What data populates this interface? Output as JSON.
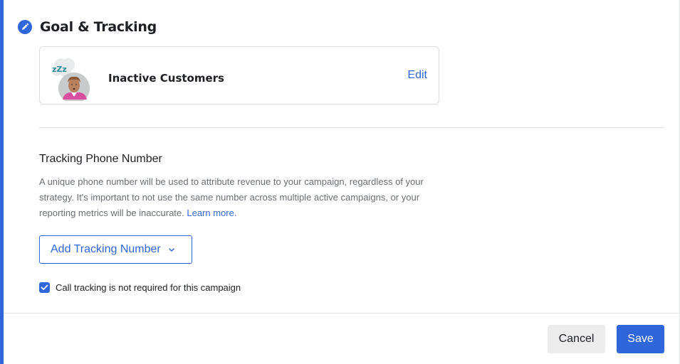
{
  "section": {
    "title": "Goal & Tracking",
    "icon": "pencil-icon"
  },
  "goal": {
    "name": "Inactive Customers",
    "edit_label": "Edit",
    "avatar_icon": "sleeping-customer-avatar",
    "zzz_text": "zZz"
  },
  "tracking": {
    "title": "Tracking Phone Number",
    "description": "A unique phone number will be used to attribute revenue to your campaign, regardless of your strategy. It's important to not use the same number across multiple active campaigns, or your reporting metrics will be inaccurate. ",
    "learn_more": "Learn more.",
    "add_button_label": "Add Tracking Number",
    "checkbox_label": "Call tracking is not required for this campaign",
    "checkbox_checked": true
  },
  "footer": {
    "cancel_label": "Cancel",
    "save_label": "Save"
  },
  "colors": {
    "accent": "#2f67db",
    "text": "#1d1f24",
    "muted_text": "#6b6f76",
    "border": "#dcdee2",
    "cancel_bg": "#ececed"
  }
}
